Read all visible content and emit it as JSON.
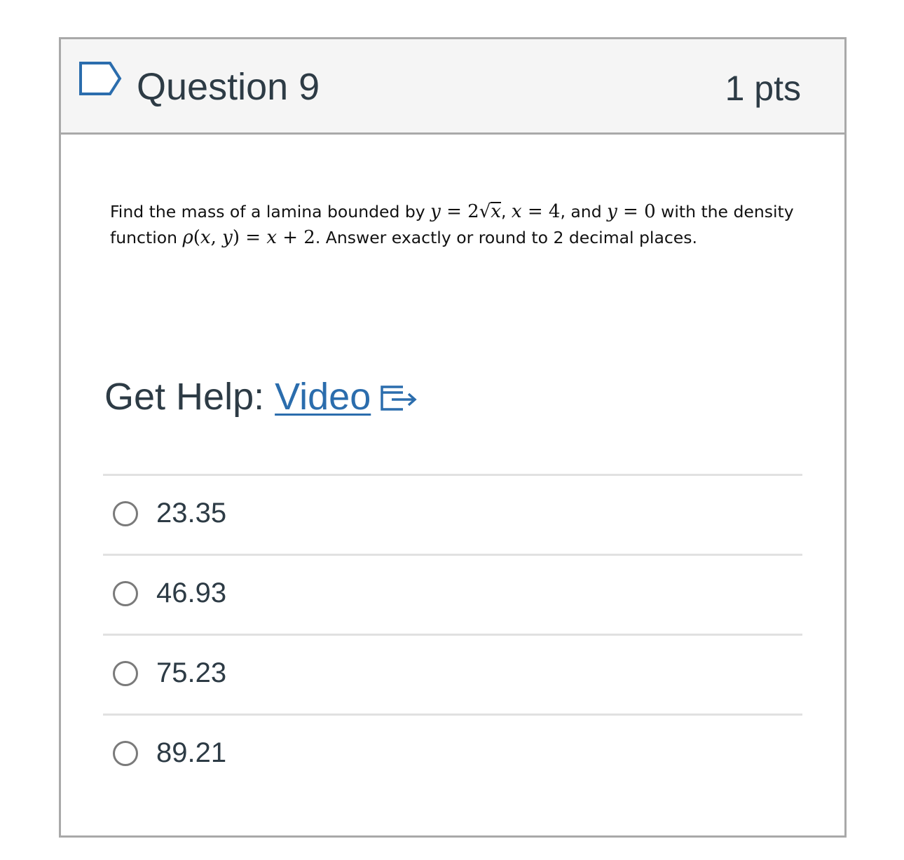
{
  "question": {
    "title": "Question 9",
    "points": "1 pts"
  },
  "prompt": {
    "p1": "Find the mass of a lamina bounded by ",
    "m_y1": "y",
    "m_eq1": " = 2",
    "m_sqrt_x": "x",
    "p2": ", ",
    "m_x1": "x",
    "m_eq2": " = 4",
    "p3": ", and ",
    "m_y2": "y",
    "m_eq3": " = 0",
    "p4": " with the density function ",
    "m_rho": "ρ",
    "m_args_open": "(",
    "m_arg_x": "x",
    "m_comma": ", ",
    "m_arg_y": "y",
    "m_args_close": ")",
    "m_eq4": " = ",
    "m_x2": "x",
    "m_plus": " + 2",
    "p5": ". Answer exactly or round to 2 decimal places."
  },
  "help": {
    "label": "Get Help: ",
    "link_text": "Video"
  },
  "answers": [
    {
      "label": "23.35"
    },
    {
      "label": "46.93"
    },
    {
      "label": "75.23"
    },
    {
      "label": "89.21"
    }
  ],
  "colors": {
    "link": "#2b6dad",
    "header_bg": "#f5f5f5",
    "border": "#a9a9a9"
  },
  "icons": {
    "flag": "bookmark-flag-icon",
    "external": "external-link-icon"
  }
}
